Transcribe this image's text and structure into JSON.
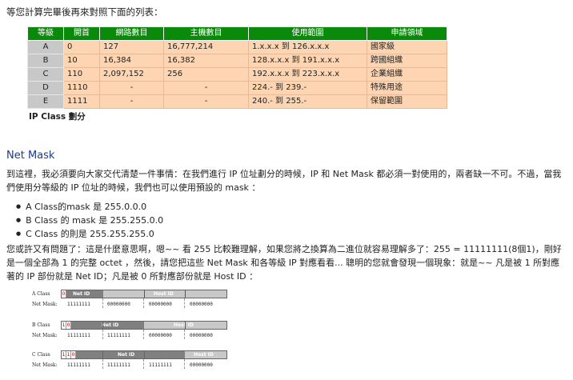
{
  "intro": "等您計算完畢後再來對照下面的列表：",
  "table": {
    "headers": [
      "等級",
      "開首",
      "網路數目",
      "主機數目",
      "使用範圍",
      "申請領域"
    ],
    "rows": [
      [
        "A",
        "0",
        "127",
        "16,777,214",
        "1.x.x.x 到 126.x.x.x",
        "國家級"
      ],
      [
        "B",
        "10",
        "16,384",
        "16,382",
        "128.x.x.x 到 191.x.x.x",
        "跨國組織"
      ],
      [
        "C",
        "110",
        "2,097,152",
        "256",
        "192.x.x.x 到 223.x.x.x",
        "企業組織"
      ],
      [
        "D",
        "1110",
        "-",
        "-",
        "224.- 到 239.-",
        "特殊用途"
      ],
      [
        "E",
        "1111",
        "-",
        "-",
        "240.- 到 255.-",
        "保留範圍"
      ]
    ]
  },
  "table_caption": "IP Class 劃分",
  "section_title": "Net Mask",
  "para1": "到這裡，我必須要向大家交代清楚一件事情：在我們進行 IP 位址劃分的時候，IP 和 Net Mask 都必須一對使用的，兩者缺一不可。不過，當我們使用分等級的 IP 位址的時候，我們也可以使用預設的 mask ：",
  "mask_list": [
    "A Class的mask 是 255.0.0.0",
    "B Class 的 mask 是 255.255.0.0",
    "C Class 的則是 255.255.255.0"
  ],
  "para2": "您或許又有問題了：這是什麼意思啊，嗯~~ 看 255 比較難理解，如果您將之換算為二進位就容易理解多了：255 = 11111111(8個1)，剛好是一個全部為 1 的完整 octet ，然後，請您把這些 Net Mask 和各等級 IP 對應看看... 聰明的您就會發現一個現象：就是~~ 凡是被 1 所對應著的 IP 部份就是 Net ID；凡是被 0 所對應部份就是 Host ID ：",
  "diagrams": {
    "net_mask_label": "Net Mask:",
    "net_id_label": "Net ID",
    "host_id_label": "Host ID",
    "a": {
      "class_label": "A Class",
      "leading_bits": [
        "0"
      ],
      "mask_octets": [
        "11111111",
        "00000000",
        "00000000",
        "00000000"
      ]
    },
    "b": {
      "class_label": "B Class",
      "leading_bits": [
        "1",
        "0"
      ],
      "mask_octets": [
        "11111111",
        "11111111",
        "00000000",
        "00000000"
      ]
    },
    "c": {
      "class_label": "C Class",
      "leading_bits": [
        "1",
        "1",
        "0"
      ],
      "mask_octets": [
        "11111111",
        "11111111",
        "11111111",
        "00000000"
      ]
    }
  },
  "colors": {
    "header_bg": "#0a8a0a",
    "row_bg": "#fdd5b2",
    "grade_bg": "#c8c8c8",
    "title_color": "#1a3a8a",
    "net_id_bg": "#808080",
    "host_id_bg": "#c8c8c8",
    "leading_bit_color": "#c00000"
  }
}
